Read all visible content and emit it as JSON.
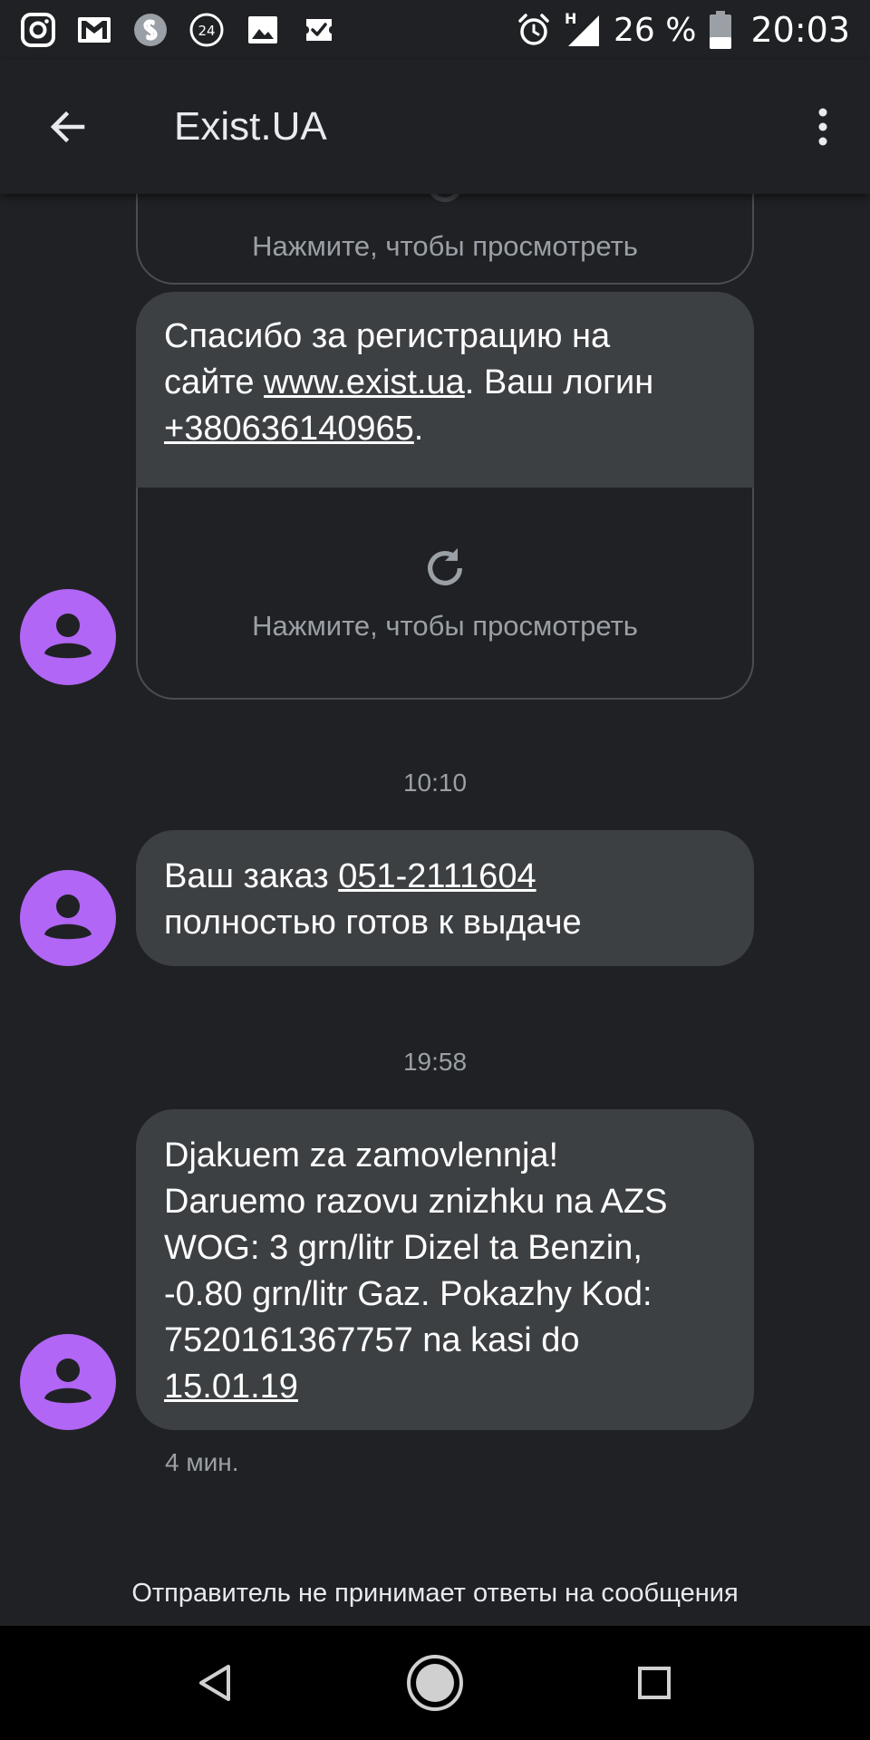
{
  "status_bar": {
    "battery": "26 %",
    "time": "20:03",
    "network_label": "H",
    "notification_icons": [
      "instagram-icon",
      "gmail-icon",
      "shazam-icon",
      "24-icon",
      "image-icon",
      "ticket-check-icon"
    ],
    "notif_badge_24": "24"
  },
  "app_bar": {
    "title": "Exist.UA"
  },
  "messages": {
    "mms_top": {
      "tap_to_view": "Нажмите, чтобы просмотреть"
    },
    "msg1": {
      "line1": "Спасибо за регистрацию на",
      "line2_prefix": "сайте ",
      "link_site": "www.exist.ua",
      "line2_suffix": ". Ваш логин",
      "link_phone": "+380636140965",
      "line3_suffix": ".",
      "tap_to_view": "Нажмите, чтобы просмотреть"
    },
    "time_1": "10:10",
    "msg2": {
      "prefix": "Ваш заказ ",
      "link_order": "051-2111604",
      "line2": "полностью готов к выдаче"
    },
    "time_2": "19:58",
    "msg3": {
      "line1": "Djakuem za zamovlennja!",
      "line2": "Daruemo razovu znizhku na AZS",
      "line3": "WOG: 3 grn/litr Dizel ta Benzin,",
      "line4": "-0.80 grn/litr Gaz. Pokazhy Kod:",
      "line5": "7520161367757 na kasi do",
      "link_date": "15.01.19",
      "meta": "4 мин."
    }
  },
  "footer": {
    "no_reply": "Отправитель не принимает ответы на сообщения"
  },
  "colors": {
    "background": "#202124",
    "bubble": "#3c4043",
    "avatar": "#b166f5",
    "nav_bar": "#000000"
  }
}
